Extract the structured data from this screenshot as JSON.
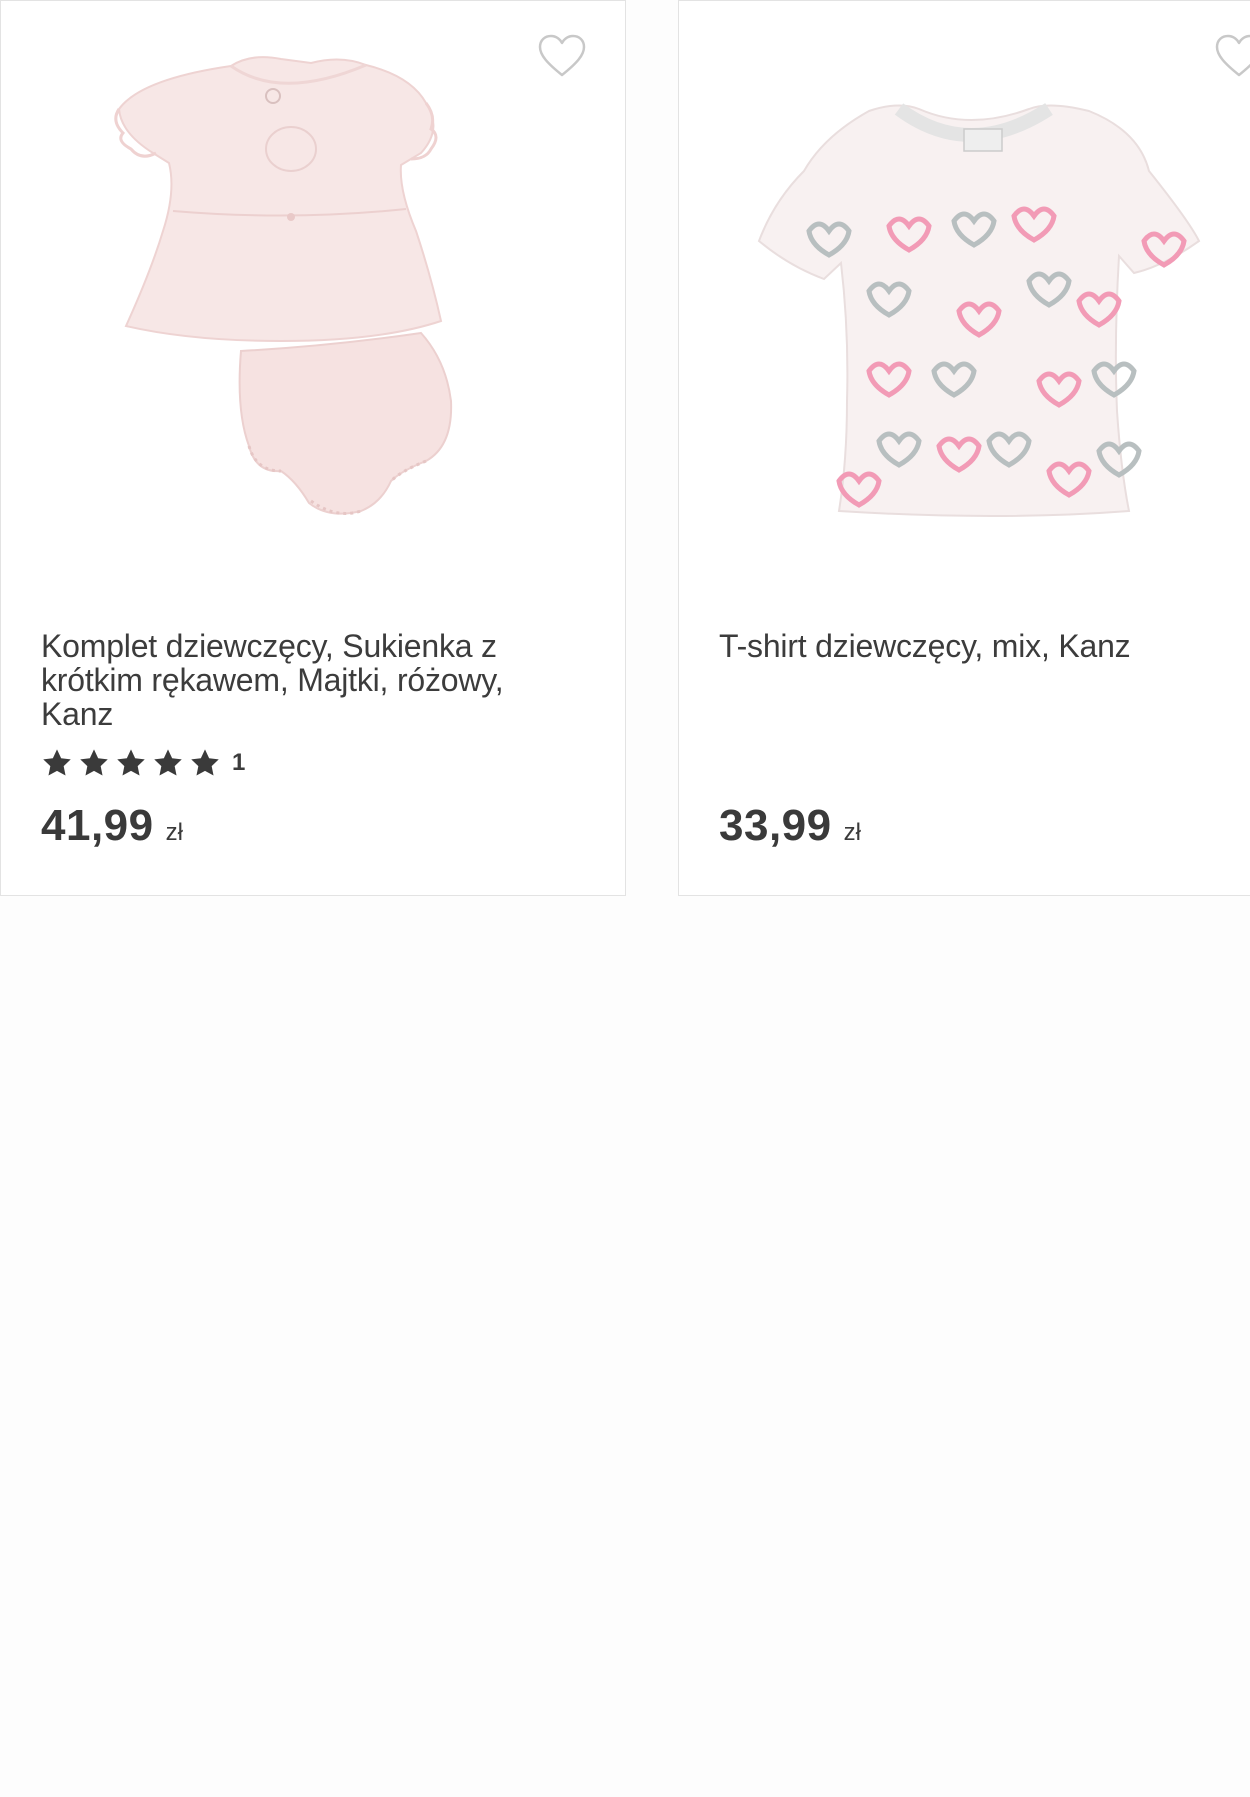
{
  "products": [
    {
      "title": "Komplet dziewczęcy, Sukienka z krótkim rękawem, Majtki, różowy, Kanz",
      "rating_stars": 5,
      "rating_count": "1",
      "price": "41,99",
      "currency": "zł",
      "favorite_icon": "heart-outline-icon",
      "image_icon": "dress-set-image"
    },
    {
      "title": "T-shirt dziewczęcy, mix, Kanz",
      "price": "33,99",
      "currency": "zł",
      "favorite_icon": "heart-outline-icon",
      "image_icon": "tshirt-image"
    }
  ],
  "colors": {
    "text": "#3c3c3c",
    "star": "#3a3a3a",
    "border": "#e3e3e3",
    "heart": "#c8c8c8",
    "garment_pink": "#f7e6e6",
    "print_pink": "#f29bb6",
    "print_grey": "#b8bfc0"
  }
}
